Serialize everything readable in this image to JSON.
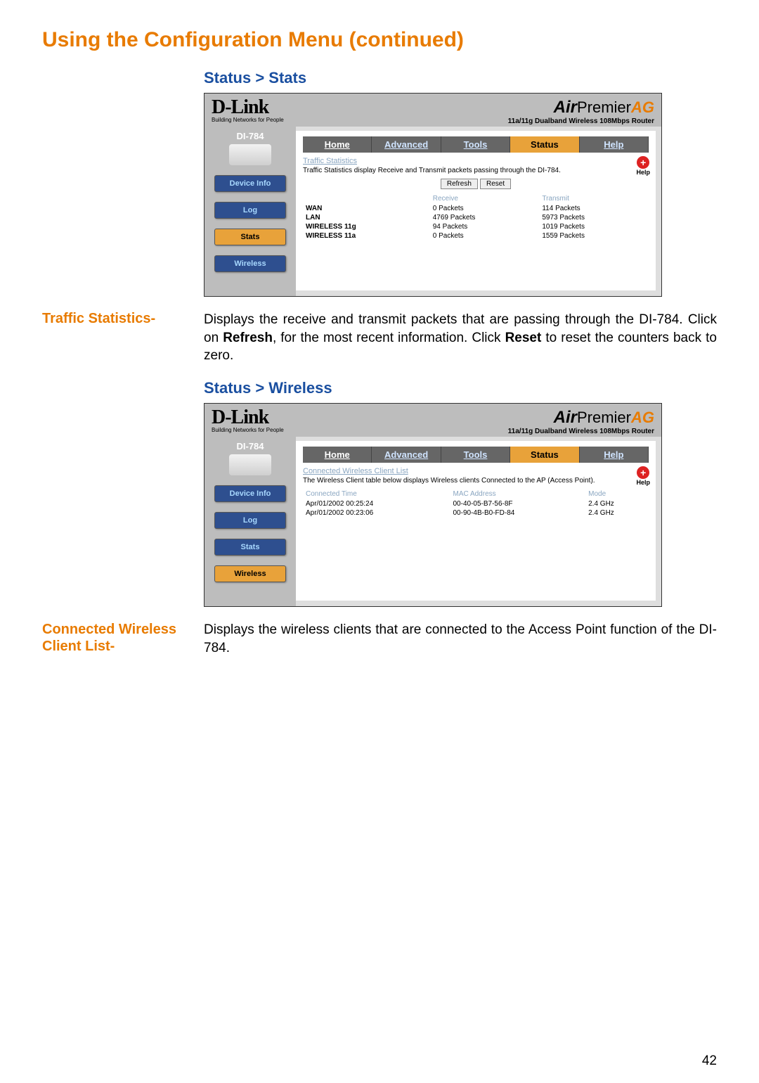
{
  "page_title": "Using the Configuration Menu (continued)",
  "page_number": "42",
  "breadcrumb1": "Status > Stats",
  "breadcrumb2": "Status > Wireless",
  "brand": {
    "logo": "D-Link",
    "tagline": "Building Networks for People",
    "product_prefix": "Air",
    "product_mid": "Premier",
    "product_suffix": "AG",
    "product_sub": "11a/11g Dualband Wireless 108Mbps Router",
    "model": "DI-784"
  },
  "sidebar": {
    "device_info": "Device Info",
    "log": "Log",
    "stats": "Stats",
    "wireless": "Wireless"
  },
  "tabs": {
    "home": "Home",
    "advanced": "Advanced",
    "tools": "Tools",
    "status": "Status",
    "help": "Help"
  },
  "stats_panel": {
    "section_title": "Traffic Statistics",
    "description": "Traffic Statistics display Receive and Transmit packets passing through the DI-784.",
    "refresh": "Refresh",
    "reset": "Reset",
    "help_label": "Help",
    "col_receive": "Receive",
    "col_transmit": "Transmit",
    "rows": [
      {
        "label": "WAN",
        "receive": "0 Packets",
        "transmit": "114 Packets"
      },
      {
        "label": "LAN",
        "receive": "4769 Packets",
        "transmit": "5973 Packets"
      },
      {
        "label": "WIRELESS 11g",
        "receive": "94 Packets",
        "transmit": "1019 Packets"
      },
      {
        "label": "WIRELESS 11a",
        "receive": "0 Packets",
        "transmit": "1559 Packets"
      }
    ]
  },
  "wireless_panel": {
    "section_title": "Connected Wireless Client List",
    "description": "The Wireless Client table below displays Wireless clients Connected to the AP (Access Point).",
    "help_label": "Help",
    "col_time": "Connected Time",
    "col_mac": "MAC Address",
    "col_mode": "Mode",
    "rows": [
      {
        "time": "Apr/01/2002 00:25:24",
        "mac": "00-40-05-B7-56-8F",
        "mode": "2.4 GHz"
      },
      {
        "time": "Apr/01/2002 00:23:06",
        "mac": "00-90-4B-B0-FD-84",
        "mode": "2.4 GHz"
      }
    ]
  },
  "entry1": {
    "label": "Traffic Statistics-",
    "text_a": "Displays the receive and transmit packets that are passing through the DI-784. Click on ",
    "bold_a": "Refresh",
    "text_b": ", for the most recent information. Click ",
    "bold_b": "Reset",
    "text_c": " to reset the counters back to zero."
  },
  "entry2": {
    "label": "Connected Wireless Client List-",
    "text": "Displays the wireless clients that are connected to the Access Point function of the DI-784."
  }
}
